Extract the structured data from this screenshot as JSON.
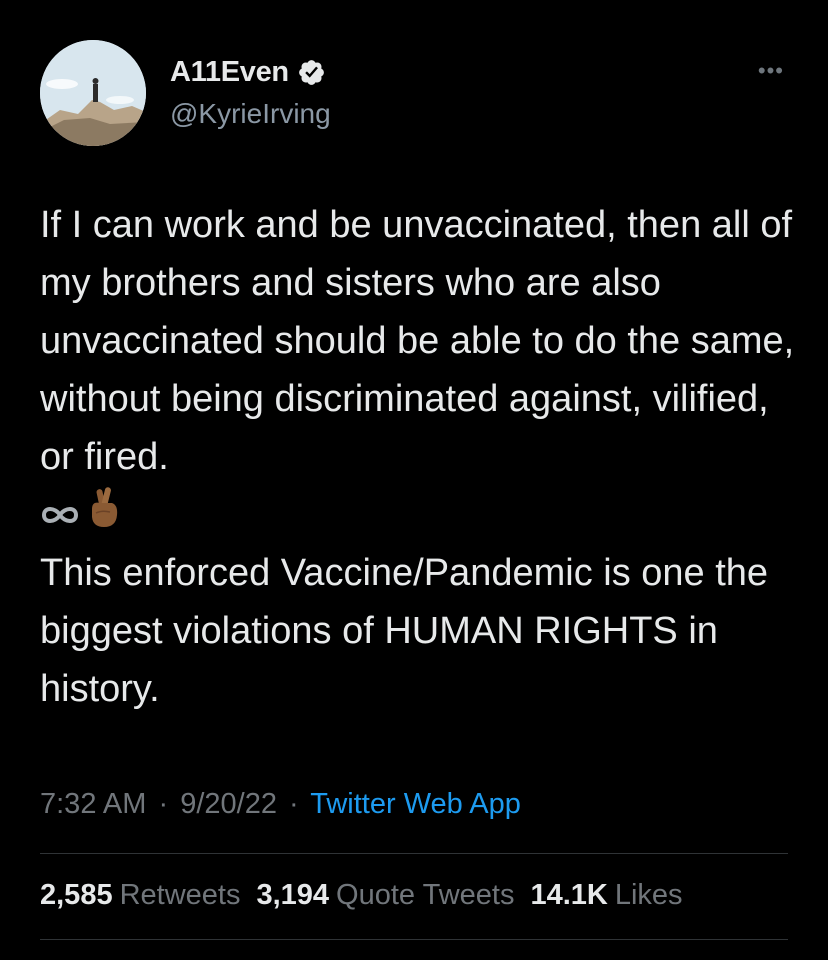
{
  "author": {
    "display_name": "A11Even",
    "handle": "@KyrieIrving",
    "verified": true,
    "avatar_icon": "avatar-photo"
  },
  "tweet": {
    "paragraph1": "If I can work and be unvaccinated, then all of my brothers and sisters who are also unvaccinated should be able to do the same, without being discriminated against, vilified, or fired.",
    "emojis": [
      "infinity-icon",
      "crossed-fingers-icon"
    ],
    "paragraph2": "This enforced Vaccine/Pandemic is one the biggest violations of HUMAN RIGHTS in history."
  },
  "meta": {
    "time": "7:32 AM",
    "separator": "·",
    "date": "9/20/22",
    "source": "Twitter Web App"
  },
  "stats": {
    "retweets_count": "2,585",
    "retweets_label": "Retweets",
    "quotes_count": "3,194",
    "quotes_label": "Quote Tweets",
    "likes_count": "14.1K",
    "likes_label": "Likes"
  },
  "colors": {
    "background": "#000000",
    "text": "#e7e9ea",
    "secondary": "#71767b",
    "link": "#1d9bf0",
    "divider": "#2f3336"
  }
}
